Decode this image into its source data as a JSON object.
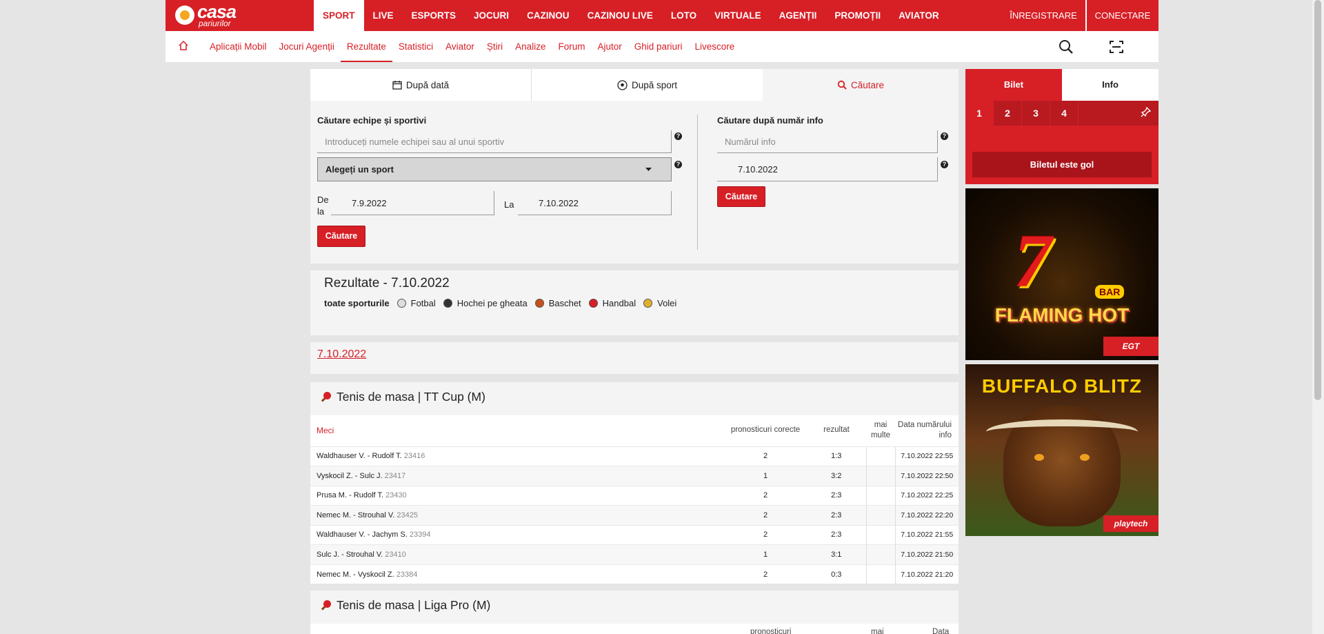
{
  "logo": {
    "line1": "casa",
    "line2": "pariurilor"
  },
  "main_nav": [
    "SPORT",
    "LIVE",
    "ESPORTS",
    "JOCURI",
    "CAZINOU",
    "CAZINOU LIVE",
    "LOTO",
    "VIRTUALE",
    "AGENȚII",
    "PROMOȚII",
    "AVIATOR"
  ],
  "main_nav_active": "SPORT",
  "auth": {
    "register": "ÎNREGISTRARE",
    "login": "CONECTARE"
  },
  "sub_nav": [
    "Aplicații Mobil",
    "Jocuri Agenții",
    "Rezultate",
    "Statistici",
    "Aviator",
    "Știri",
    "Analize",
    "Forum",
    "Ajutor",
    "Ghid pariuri",
    "Livescore"
  ],
  "sub_nav_active": "Rezultate",
  "tabs": {
    "by_date": "După dată",
    "by_sport": "După sport",
    "search": "Căutare"
  },
  "search": {
    "teams_label": "Căutare echipe și sportivi",
    "teams_placeholder": "Introduceți numele echipei sau al unui sportiv",
    "sport_select": "Alegeți un sport",
    "from_label": "De la",
    "from_value": "7.9.2022",
    "to_label": "La",
    "to_value": "7.10.2022",
    "button": "Căutare",
    "info_label": "Căutare după număr info",
    "info_placeholder": "Numărul info",
    "info_date": "7.10.2022",
    "info_button": "Căutare",
    "help": "?"
  },
  "results": {
    "title": "Rezultate - 7.10.2022",
    "all_sports": "toate sporturile",
    "sports": [
      {
        "name": "Fotbal",
        "color": "#dddddd"
      },
      {
        "name": "Hochei pe gheata",
        "color": "#333333"
      },
      {
        "name": "Baschet",
        "color": "#c8501a"
      },
      {
        "name": "Handbal",
        "color": "#d71f26"
      },
      {
        "name": "Volei",
        "color": "#e0b030"
      }
    ]
  },
  "date_link": "7.10.2022",
  "league1": {
    "title": "Tenis de masa | TT Cup (M)",
    "columns": {
      "match": "Meci",
      "correct": "pronosticuri corecte",
      "result": "rezultat",
      "more": "mai multe",
      "date": "Data numărului info"
    },
    "rows": [
      {
        "match": "Waldhauser V. - Rudolf T.",
        "id": "23416",
        "correct": "2",
        "result": "1:3",
        "date": "7.10.2022 22:55"
      },
      {
        "match": "Vyskocil Z. - Sulc J.",
        "id": "23417",
        "correct": "1",
        "result": "3:2",
        "date": "7.10.2022 22:50"
      },
      {
        "match": "Prusa M. - Rudolf T.",
        "id": "23430",
        "correct": "2",
        "result": "2:3",
        "date": "7.10.2022 22:25"
      },
      {
        "match": "Nemec M. - Strouhal V.",
        "id": "23425",
        "correct": "2",
        "result": "2:3",
        "date": "7.10.2022 22:20"
      },
      {
        "match": "Waldhauser V. - Jachym S.",
        "id": "23394",
        "correct": "2",
        "result": "2:3",
        "date": "7.10.2022 21:55"
      },
      {
        "match": "Sulc J. - Strouhal V.",
        "id": "23410",
        "correct": "1",
        "result": "3:1",
        "date": "7.10.2022 21:50"
      },
      {
        "match": "Nemec M. - Vyskocil Z.",
        "id": "23384",
        "correct": "2",
        "result": "0:3",
        "date": "7.10.2022 21:20"
      }
    ]
  },
  "league2": {
    "title": "Tenis de masa | Liga Pro (M)",
    "columns": {
      "correct": "pronosticuri",
      "more": "mai",
      "date": "Data"
    }
  },
  "betslip": {
    "tab_ticket": "Bilet",
    "tab_info": "Info",
    "numbers": [
      "1",
      "2",
      "3",
      "4"
    ],
    "empty": "Biletul este gol"
  },
  "ads": {
    "ad1": {
      "big": "7",
      "title": "FLAMING HOT",
      "bar": "BAR",
      "brand": "EGT"
    },
    "ad2": {
      "title": "BUFFALO BLITZ",
      "brand": "playtech"
    }
  }
}
